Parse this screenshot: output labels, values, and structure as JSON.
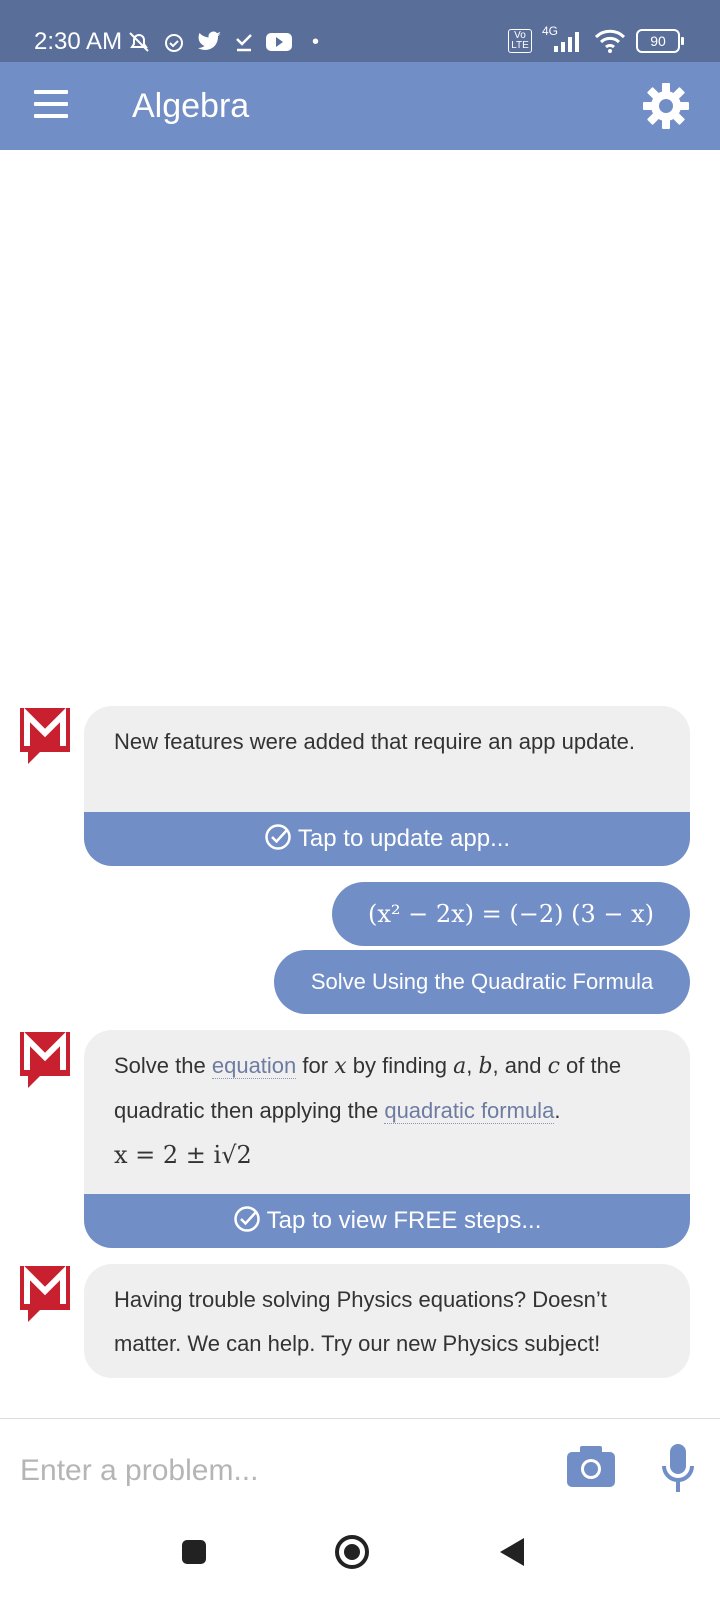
{
  "status_bar": {
    "time": "2:30 AM",
    "network": "4G",
    "volte": "Vo LTE",
    "battery": "90"
  },
  "app_bar": {
    "title": "Algebra",
    "menu_icon": "hamburger-menu-icon",
    "settings_icon": "gear-icon"
  },
  "messages": {
    "update": {
      "text": "New features were added that require an app update.",
      "action_label": "Tap to update app..."
    },
    "user_equation": "(x² − 2x) = (−2) (3 − x)",
    "user_method": "Solve Using the Quadratic Formula",
    "solution": {
      "text_1": "Solve the",
      "link_equation": "equation",
      "text_2": "for",
      "var_x": "x",
      "text_3": "by finding",
      "var_a": "a",
      "var_b": "b",
      "text_4": ", and",
      "var_c": "c",
      "text_5": "of the quadratic then applying the",
      "link_formula": "quadratic formula",
      "text_6": ".",
      "answer": "x = 2 ± i√2",
      "action_label": "Tap to view FREE steps..."
    },
    "promo": {
      "text": "Having trouble solving Physics equations? Doesn’t matter. We can help. Try our new Physics subject!"
    }
  },
  "input": {
    "placeholder": "Enter a problem..."
  },
  "colors": {
    "status_bar": "#5a6e9a",
    "accent": "#728ec6",
    "bubble": "#efefef",
    "logo_red": "#c8202f"
  }
}
